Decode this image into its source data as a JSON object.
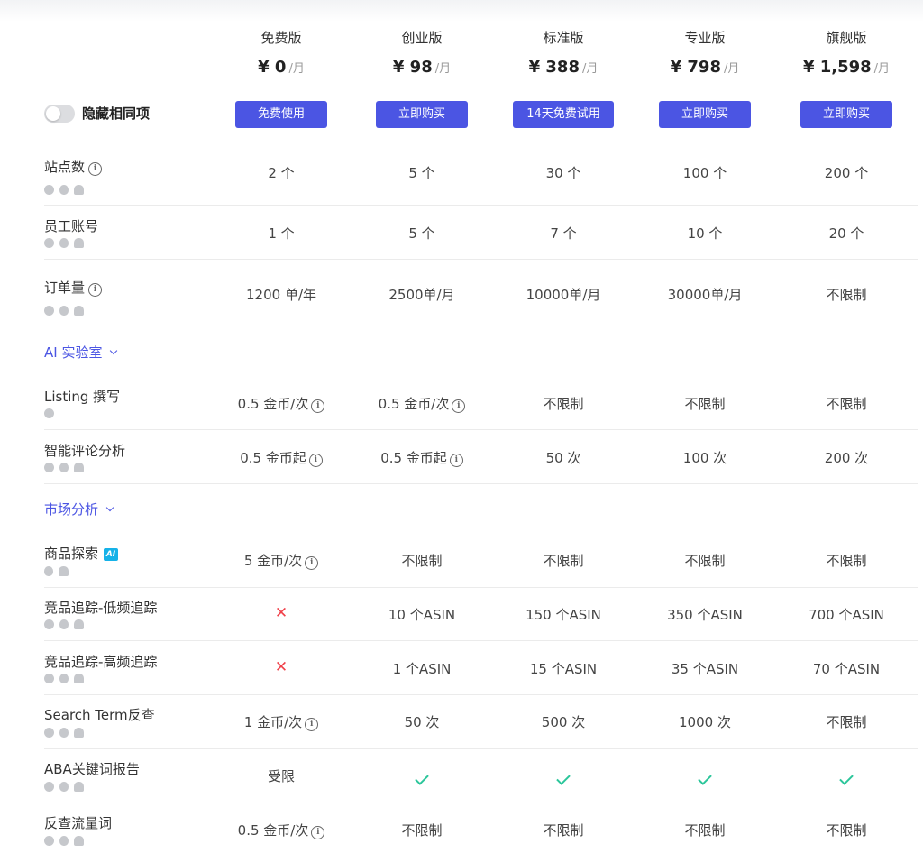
{
  "plans": [
    {
      "name": "免费版",
      "price": "¥ 0",
      "unit": "/月",
      "button": "免费使用"
    },
    {
      "name": "创业版",
      "price": "¥ 98",
      "unit": "/月",
      "button": "立即购买"
    },
    {
      "name": "标准版",
      "price": "¥ 388",
      "unit": "/月",
      "button": "14天免费试用"
    },
    {
      "name": "专业版",
      "price": "¥ 798",
      "unit": "/月",
      "button": "立即购买"
    },
    {
      "name": "旗舰版",
      "price": "¥ 1,598",
      "unit": "/月",
      "button": "立即购买"
    }
  ],
  "toggle": {
    "label": "隐藏相同项",
    "on": false
  },
  "rows": [
    {
      "name": "站点数",
      "info": true,
      "platforms": [
        "web",
        "ios",
        "android"
      ],
      "values": [
        "2 个",
        "5 个",
        "30 个",
        "100 个",
        "200 个"
      ]
    },
    {
      "name": "员工账号",
      "info": false,
      "platforms": [
        "web",
        "ios",
        "android"
      ],
      "values": [
        "1 个",
        "5 个",
        "7 个",
        "10 个",
        "20 个"
      ]
    },
    {
      "name": "订单量",
      "info": true,
      "platforms": [
        "web",
        "ios",
        "android"
      ],
      "values": [
        "1200 单/年",
        "2500单/月",
        "10000单/月",
        "30000单/月",
        "不限制"
      ]
    },
    {
      "name": "Listing 撰写",
      "info": false,
      "platforms": [
        "web"
      ],
      "values": [
        "0.5 金币/次",
        "0.5 金币/次",
        "不限制",
        "不限制",
        "不限制"
      ]
    },
    {
      "name": "智能评论分析",
      "info": false,
      "platforms": [
        "web",
        "ios",
        "android"
      ],
      "values": [
        "0.5 金币起",
        "0.5 金币起",
        "50 次",
        "100 次",
        "200 次"
      ]
    },
    {
      "name": "商品探索",
      "info": false,
      "ai": "AI",
      "platforms": [
        "ios",
        "android"
      ],
      "values": [
        "5 金币/次",
        "不限制",
        "不限制",
        "不限制",
        "不限制"
      ]
    },
    {
      "name": "竞品追踪-低频追踪",
      "info": false,
      "platforms": [
        "web",
        "ios",
        "android"
      ],
      "values": [
        "✕",
        "10 个ASIN",
        "150 个ASIN",
        "350 个ASIN",
        "700 个ASIN"
      ]
    },
    {
      "name": "竞品追踪-高频追踪",
      "info": false,
      "platforms": [
        "web",
        "ios",
        "android"
      ],
      "values": [
        "✕",
        "1 个ASIN",
        "15 个ASIN",
        "35 个ASIN",
        "70 个ASIN"
      ]
    },
    {
      "name": "Search Term反查",
      "info": false,
      "platforms": [
        "web",
        "ios",
        "android"
      ],
      "values": [
        "1 金币/次",
        "50 次",
        "500 次",
        "1000 次",
        "不限制"
      ]
    },
    {
      "name": "ABA关键词报告",
      "info": false,
      "platforms": [
        "web",
        "ios",
        "android"
      ],
      "values": [
        "受限",
        "✓",
        "✓",
        "✓",
        "✓"
      ]
    },
    {
      "name": "反查流量词",
      "info": false,
      "platforms": [
        "web",
        "ios",
        "android"
      ],
      "values": [
        "0.5 金币/次",
        "不限制",
        "不限制",
        "不限制",
        "不限制"
      ]
    }
  ],
  "sections": {
    "ai_lab": "AI 实验室",
    "market": "市场分析"
  },
  "colors": {
    "accent": "#4b55e3",
    "check": "#2cc69b",
    "cross": "#f0414a"
  }
}
